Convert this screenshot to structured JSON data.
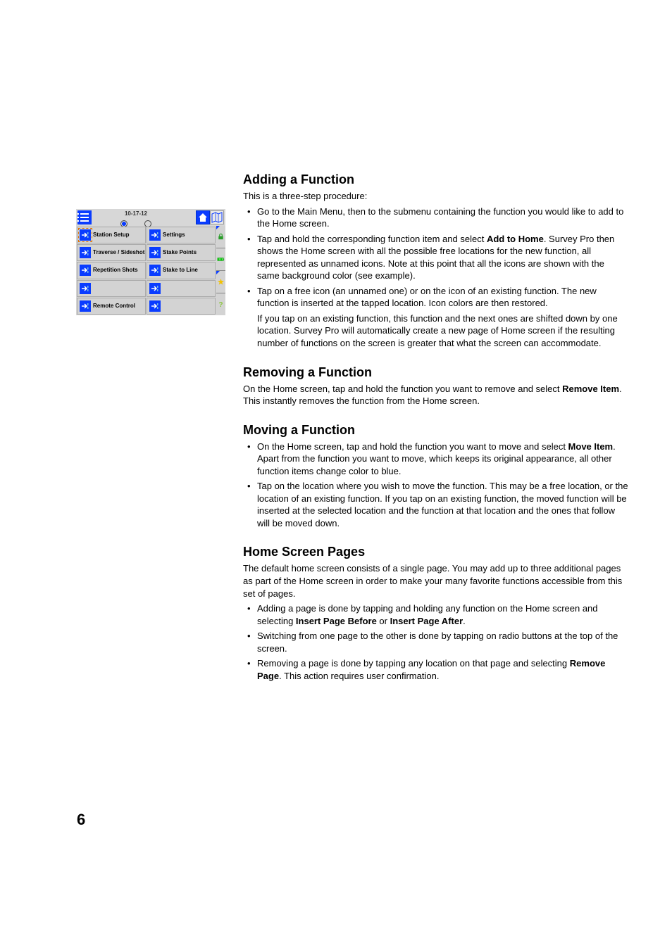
{
  "page_number": "6",
  "sections": {
    "adding": {
      "title": "Adding a Function",
      "intro": "This is a three-step procedure:",
      "b1": "Go to the Main Menu, then to the submenu containing the function you would like to add to the Home screen.",
      "b2a": "Tap and hold the corresponding function item and select ",
      "b2bold": "Add to Home",
      "b2b": ". Survey Pro then shows the Home screen with all the possible free locations for the new function, all represented as unnamed icons. Note at this point that all the icons are shown with the same background color (see example).",
      "b3a": "Tap on a free icon (an unnamed one) or on the icon of an existing function. The new function is inserted at the tapped location. Icon colors are then restored.",
      "b3follow": "If you tap on an existing function, this function and the next ones are shifted down by one location. Survey Pro will automatically create a new page of Home screen if the resulting number of functions on the screen is greater that what the screen can accommodate."
    },
    "removing": {
      "title": "Removing a Function",
      "p1a": "On the Home screen, tap and hold the function you want to remove and select ",
      "p1bold": "Remove Item",
      "p1b": ". This instantly removes the function from the Home screen."
    },
    "moving": {
      "title": "Moving a Function",
      "b1a": "On the Home screen, tap and hold the function you want to move and select ",
      "b1bold": "Move Item",
      "b1b": ". Apart from the function you want to move, which keeps its original appearance, all other function items change color to blue.",
      "b2": "Tap on the location where you wish to move the function. This may be a free location, or the location of an existing function. If you tap on an existing function, the moved function will be inserted at the selected location and the function at that location and the ones that follow will be moved down."
    },
    "pages": {
      "title": "Home Screen Pages",
      "p1": "The default home screen consists of a single page. You may add up to three additional pages as part of the Home screen in order to make your many favorite functions accessible from this set of pages.",
      "b1a": "Adding a page is done by tapping and holding any function on the Home screen and selecting ",
      "b1bold1": "Insert Page Before",
      "b1mid": " or ",
      "b1bold2": "Insert Page After",
      "b1end": ".",
      "b2": "Switching from one page to the other is done by tapping on radio buttons at the top of the screen.",
      "b3a": "Removing a page is done by tapping any location on that page and selecting ",
      "b3bold": "Remove Page",
      "b3b": ". This action requires user confirmation."
    }
  },
  "mock": {
    "date": "10-17-12",
    "items": {
      "c1": "Station Setup",
      "c2": "Settings",
      "c3": "Traverse / Sideshot",
      "c4": "Stake Points",
      "c5": "Repetition Shots",
      "c6": "Stake to Line",
      "c9": "Remote Control"
    }
  }
}
